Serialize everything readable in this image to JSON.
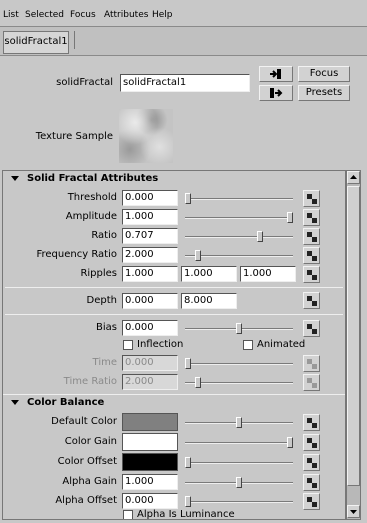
{
  "menu": [
    "List",
    "Selected",
    "Focus",
    "Attributes",
    "Help"
  ],
  "tab": {
    "label": "solidFractal1"
  },
  "node": {
    "type_label": "solidFractal",
    "name_value": "solidFractal1",
    "focus_label": "Focus",
    "presets_label": "Presets"
  },
  "texture_sample_label": "Texture Sample",
  "solid_fractal": {
    "title": "Solid Fractal Attributes",
    "threshold": {
      "label": "Threshold",
      "value": "0.000",
      "slider": 0.0
    },
    "amplitude": {
      "label": "Amplitude",
      "value": "1.000",
      "slider": 1.0
    },
    "ratio": {
      "label": "Ratio",
      "value": "0.707",
      "slider": 0.707
    },
    "frequency_ratio": {
      "label": "Frequency Ratio",
      "value": "2.000",
      "slider": 0.1
    },
    "ripples": {
      "label": "Ripples",
      "values": [
        "1.000",
        "1.000",
        "1.000"
      ]
    },
    "depth": {
      "label": "Depth",
      "values": [
        "0.000",
        "8.000"
      ]
    },
    "bias": {
      "label": "Bias",
      "value": "0.000",
      "slider": 0.5
    },
    "inflection": {
      "label": "Inflection",
      "checked": false
    },
    "animated": {
      "label": "Animated",
      "checked": false
    },
    "time": {
      "label": "Time",
      "value": "0.000",
      "slider": 0.0,
      "disabled": true
    },
    "time_ratio": {
      "label": "Time Ratio",
      "value": "2.000",
      "slider": 0.1,
      "disabled": true
    }
  },
  "color_balance": {
    "title": "Color Balance",
    "default_color": {
      "label": "Default Color",
      "color": "#808080",
      "slider": 0.5
    },
    "color_gain": {
      "label": "Color Gain",
      "color": "#ffffff",
      "slider": 1.0
    },
    "color_offset": {
      "label": "Color Offset",
      "color": "#000000",
      "slider": 0.0
    },
    "alpha_gain": {
      "label": "Alpha Gain",
      "value": "1.000",
      "slider": 0.5
    },
    "alpha_offset": {
      "label": "Alpha Offset",
      "value": "0.000",
      "slider": 0.0
    },
    "alpha_is_luminance": {
      "label": "Alpha Is Luminance",
      "checked": false
    }
  }
}
